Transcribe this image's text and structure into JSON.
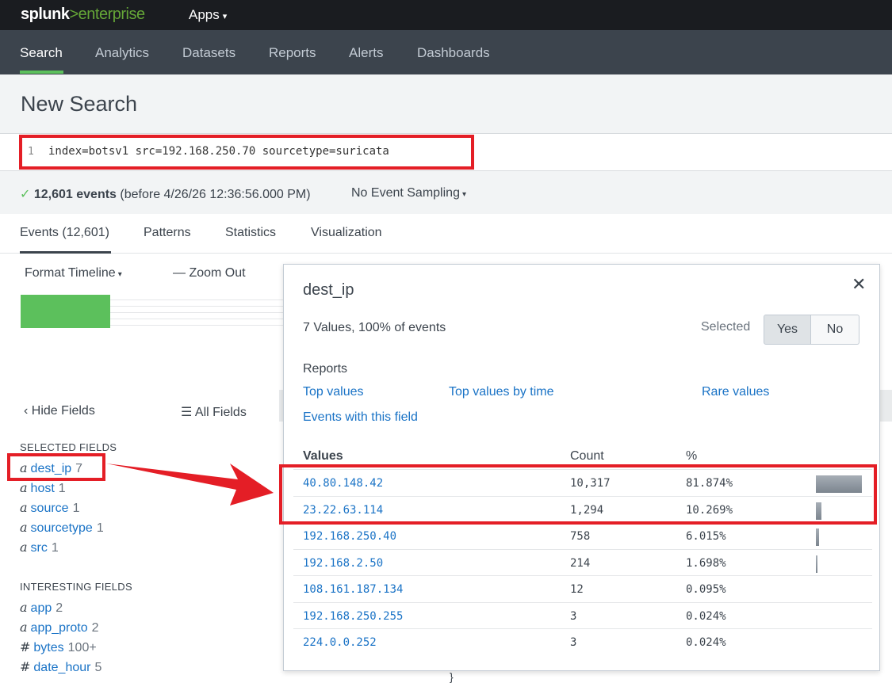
{
  "topbar": {
    "logo_main": "splunk",
    "logo_gt": ">",
    "logo_product": "enterprise",
    "apps_label": "Apps",
    "apps_caret": "▾"
  },
  "nav": {
    "items": [
      "Search",
      "Analytics",
      "Datasets",
      "Reports",
      "Alerts",
      "Dashboards"
    ],
    "active": "Search"
  },
  "page": {
    "title": "New Search"
  },
  "search": {
    "line_number": "1",
    "query": "index=botsv1 src=192.168.250.70 sourcetype=suricata"
  },
  "status": {
    "check": "✓",
    "count": "12,601 events",
    "before": "(before 4/26/26 12:36:56.000 PM)",
    "sampling": "No Event Sampling",
    "sampling_caret": "▾"
  },
  "tabs": [
    "Events (12,601)",
    "Patterns",
    "Statistics",
    "Visualization"
  ],
  "timeline": {
    "format": "Format Timeline",
    "format_caret": "▾",
    "zoom_out": "— Zoom Out"
  },
  "fields_panel": {
    "hide_fields": "Hide Fields",
    "hide_icon": "‹",
    "all_fields": "All Fields",
    "all_icon": "☰",
    "selected_heading": "SELECTED FIELDS",
    "selected": [
      {
        "type": "a",
        "name": "dest_ip",
        "count": "7"
      },
      {
        "type": "a",
        "name": "host",
        "count": "1"
      },
      {
        "type": "a",
        "name": "source",
        "count": "1"
      },
      {
        "type": "a",
        "name": "sourcetype",
        "count": "1"
      },
      {
        "type": "a",
        "name": "src",
        "count": "1"
      }
    ],
    "interesting_heading": "INTERESTING FIELDS",
    "interesting": [
      {
        "type": "a",
        "name": "app",
        "count": "2"
      },
      {
        "type": "a",
        "name": "app_proto",
        "count": "2"
      },
      {
        "type": "#",
        "name": "bytes",
        "count": "100+"
      },
      {
        "type": "#",
        "name": "date_hour",
        "count": "5"
      }
    ]
  },
  "popover": {
    "title": "dest_ip",
    "close": "✕",
    "summary": "7 Values, 100% of events",
    "selected_label": "Selected",
    "yes": "Yes",
    "no": "No",
    "selected_value": "Yes",
    "reports_heading": "Reports",
    "reports": [
      "Top values",
      "Top values by time",
      "Rare values",
      "Events with this field"
    ],
    "headers": {
      "values": "Values",
      "count": "Count",
      "pct": "%"
    },
    "rows": [
      {
        "value": "40.80.148.42",
        "count": "10,317",
        "pct": "81.874%",
        "share": 0.81874
      },
      {
        "value": "23.22.63.114",
        "count": "1,294",
        "pct": "10.269%",
        "share": 0.10269
      },
      {
        "value": "192.168.250.40",
        "count": "758",
        "pct": "6.015%",
        "share": 0.06015
      },
      {
        "value": "192.168.2.50",
        "count": "214",
        "pct": "1.698%",
        "share": 0.01698
      },
      {
        "value": "108.161.187.134",
        "count": "12",
        "pct": "0.095%",
        "share": 0.00095
      },
      {
        "value": "192.168.250.255",
        "count": "3",
        "pct": "0.024%",
        "share": 0.00024
      },
      {
        "value": "224.0.0.252",
        "count": "3",
        "pct": "0.024%",
        "share": 0.00024
      }
    ]
  },
  "colors": {
    "highlight": "#e41e26",
    "link": "#1a73c6",
    "accent_green": "#5cc05c"
  },
  "misc": {
    "brace": "}"
  }
}
